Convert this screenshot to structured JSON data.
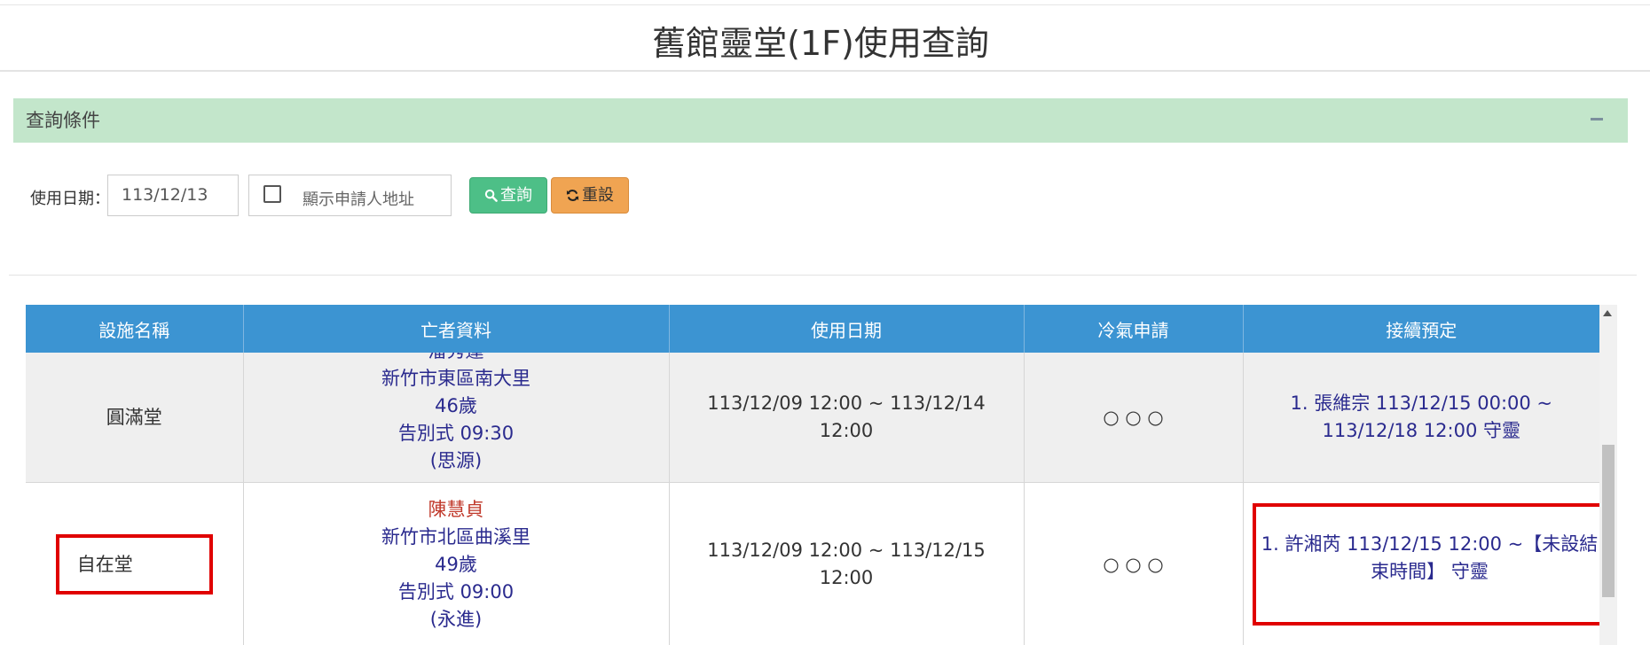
{
  "page": {
    "title": "舊館靈堂(1F)使用查詢"
  },
  "conditions": {
    "title": "查詢條件",
    "collapse_icon": "minus-icon"
  },
  "filters": {
    "date_label": "使用日期：",
    "date_value": "113/12/13",
    "show_address_label": "顯示申請人地址",
    "show_address_checked": false,
    "search_label": "查詢",
    "reset_label": "重設"
  },
  "table": {
    "headers": [
      "設施名稱",
      "亡者資料",
      "使用日期",
      "冷氣申請",
      "接續預定"
    ],
    "rows": [
      {
        "facility": "圓滿堂",
        "deceased_name_partial": "潘秀蓮",
        "deceased_address": "新竹市東區南大里",
        "deceased_age": "46歲",
        "ceremony": "告別式 09:30",
        "ceremony_place": "(思源)",
        "period": "113/12/09 12:00 ~ 113/12/14 12:00",
        "ac": "○ ○ ○",
        "next_line1": "1. 張維宗 113/12/15 00:00 ~",
        "next_line2": "113/12/18 12:00 守靈"
      },
      {
        "facility": "自在堂",
        "deceased_name": "陳慧貞",
        "deceased_address": "新竹市北區曲溪里",
        "deceased_age": "49歲",
        "ceremony": "告別式 09:00",
        "ceremony_place": "(永進)",
        "period": "113/12/09 12:00 ~ 113/12/15 12:00",
        "ac": "○ ○ ○",
        "next_line1": "1. 許湘芮 113/12/15 12:00 ~【未設結",
        "next_line2": "束時間】 守靈"
      }
    ]
  },
  "colors": {
    "header_blue": "#3c94d2",
    "condition_green": "#c3e6cb",
    "search_button": "#4dbf87",
    "reset_button": "#f0a452",
    "highlight_red": "#e00000",
    "name_red": "#c0392b"
  }
}
